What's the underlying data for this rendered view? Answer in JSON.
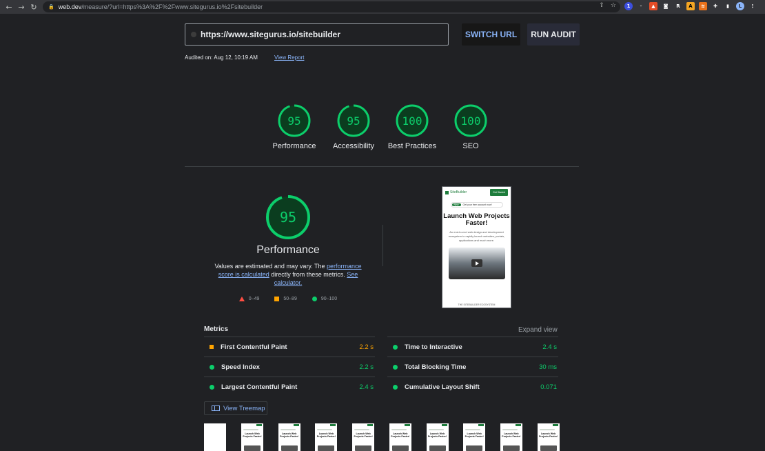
{
  "browser": {
    "url_host": "web.dev",
    "url_path": "/measure/?url=https%3A%2F%2Fwww.sitegurus.io%2Fsitebuilder",
    "profile_initial": "L"
  },
  "audit": {
    "url_value": "https://www.sitegurus.io/sitebuilder",
    "switch_label": "SWITCH URL",
    "run_label": "RUN AUDIT",
    "audited_text": "Audited on: Aug 12, 10:19 AM",
    "view_report": "View Report"
  },
  "scores": [
    {
      "label": "Performance",
      "value": 95
    },
    {
      "label": "Accessibility",
      "value": 95
    },
    {
      "label": "Best Practices",
      "value": 100
    },
    {
      "label": "SEO",
      "value": 100
    }
  ],
  "performance": {
    "score": 95,
    "title": "Performance",
    "desc_1": "Values are estimated and may vary. The ",
    "desc_link1": "performance score is calculated",
    "desc_2": " directly from these metrics. ",
    "desc_link2": "See calculator.",
    "legend": [
      "0–49",
      "50–89",
      "90–100"
    ]
  },
  "preview": {
    "logo": "SiteBuilder",
    "cta": "Get Started",
    "pill_tag": "New",
    "pill_text": "Get your free account now!",
    "heading": "Launch Web Projects Faster!",
    "paragraph": "An end-to-end web design and development ecosystem to rapidly launch websites, portals, applications and much more.",
    "footer": "THE SITEBUILDER ECOSYSTEM"
  },
  "metrics": {
    "header": "Metrics",
    "expand": "Expand view",
    "items": [
      {
        "name": "First Contentful Paint",
        "value": "2.2 s",
        "status": "average"
      },
      {
        "name": "Time to Interactive",
        "value": "2.4 s",
        "status": "pass"
      },
      {
        "name": "Speed Index",
        "value": "2.2 s",
        "status": "pass"
      },
      {
        "name": "Total Blocking Time",
        "value": "30 ms",
        "status": "pass"
      },
      {
        "name": "Largest Contentful Paint",
        "value": "2.4 s",
        "status": "pass"
      },
      {
        "name": "Cumulative Layout Shift",
        "value": "0.071",
        "status": "pass"
      }
    ]
  },
  "treemap_label": "View Treemap",
  "filmstrip": {
    "frame_heading": "Launch Web Projects Faster!"
  },
  "colors": {
    "pass": "#0cce6b",
    "average": "#ffa400",
    "fail": "#ff4e42",
    "link": "#8ab4f8"
  }
}
